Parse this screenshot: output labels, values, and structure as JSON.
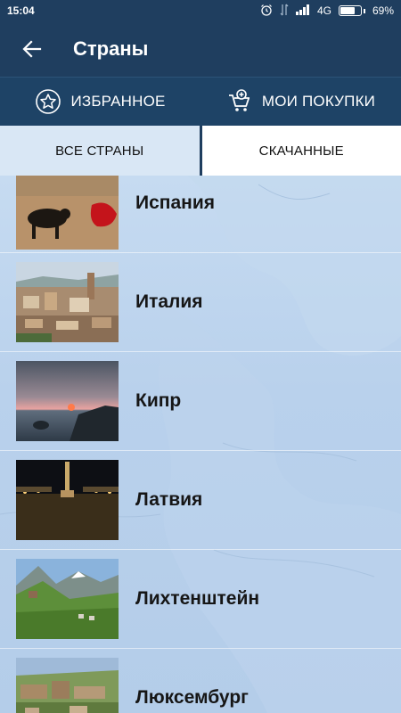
{
  "status": {
    "time": "15:04",
    "network": "4G",
    "battery": "69%"
  },
  "appbar": {
    "title": "Страны"
  },
  "actions": {
    "favorites_label": "ИЗБРАННОЕ",
    "purchases_label": "МОИ ПОКУПКИ"
  },
  "tabs": {
    "all_label": "ВСЕ СТРАНЫ",
    "downloaded_label": "СКАЧАННЫЕ"
  },
  "countries": [
    {
      "name": "Испания"
    },
    {
      "name": "Италия"
    },
    {
      "name": "Кипр"
    },
    {
      "name": "Латвия"
    },
    {
      "name": "Лихтенштейн"
    },
    {
      "name": "Люксембург"
    }
  ]
}
